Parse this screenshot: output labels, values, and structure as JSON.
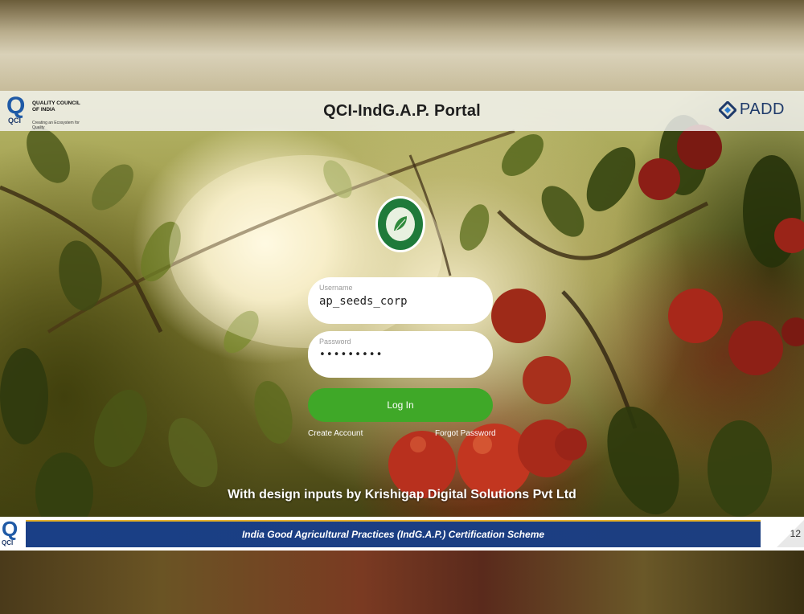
{
  "header": {
    "title": "QCI-IndG.A.P. Portal",
    "qci_logo": {
      "letter": "Q",
      "abbr": "QCI",
      "name": "QUALITY COUNCIL OF INDIA",
      "tagline": "Creating an Ecosystem for Quality"
    },
    "padd_logo": {
      "text": "PADD",
      "icon": "padd-diamond-icon",
      "color": "#1f3a6a"
    }
  },
  "emblem": {
    "icon": "leaf-seal-icon"
  },
  "login": {
    "username": {
      "label": "Username",
      "value": "ap_seeds_corp"
    },
    "password": {
      "label": "Password",
      "value": "•••••••••"
    },
    "login_button": "Log In",
    "create_account": "Create Account",
    "forgot_password": "Forgot Password",
    "button_color": "#3fa828"
  },
  "credit": "With design inputs by Krishigap Digital Solutions Pvt Ltd",
  "footer": {
    "qci_letter": "Q",
    "qci_abbr": "QCI",
    "scheme": "India Good Agricultural Practices (IndG.A.P.) Certification Scheme",
    "page_number": "12",
    "bar_color": "#1a3f86",
    "accent_color": "#e6b12a"
  }
}
